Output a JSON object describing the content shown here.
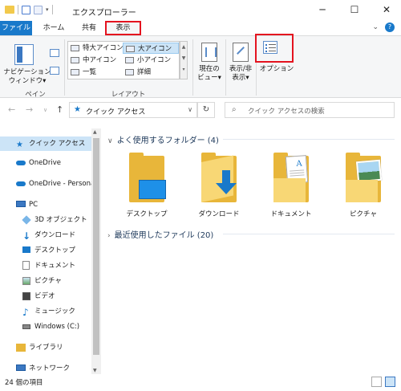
{
  "window": {
    "title": "エクスプローラー",
    "controls": [
      "─",
      "☐",
      "✕"
    ]
  },
  "ribbon_tabs": {
    "file": "ファイル",
    "home": "ホーム",
    "share": "共有",
    "view": "表示"
  },
  "ribbon": {
    "nav_pane": "ナビゲーション\nウィンドウ▾",
    "pane_group": "ペイン",
    "layout_group": "レイアウト",
    "layouts": {
      "extra_large": "特大アイコン",
      "large": "大アイコン",
      "medium": "中アイコン",
      "small": "小アイコン",
      "list": "一覧",
      "details": "詳細"
    },
    "current_view": "現在の\nビュー▾",
    "show_hide": "表示/非\n表示▾",
    "options": "オプション"
  },
  "address": {
    "path": "クイック アクセス",
    "search_placeholder": "クイック アクセスの検索"
  },
  "sidebar": {
    "quick_access": "クイック アクセス",
    "onedrive": "OneDrive",
    "onedrive_personal": "OneDrive - Persona",
    "pc": "PC",
    "objects3d": "3D オブジェクト",
    "downloads": "ダウンロード",
    "desktop": "デスクトップ",
    "documents": "ドキュメント",
    "pictures": "ピクチャ",
    "videos": "ビデオ",
    "music": "ミュージック",
    "windows_c": "Windows (C:)",
    "library": "ライブラリ",
    "network": "ネットワーク"
  },
  "content": {
    "frequent": "よく使用するフォルダー (4)",
    "recent": "最近使用したファイル (20)",
    "folders": [
      "デスクトップ",
      "ダウンロード",
      "ドキュメント",
      "ピクチャ"
    ]
  },
  "status": {
    "count": "24 個の項目"
  },
  "colors": {
    "accent": "#1979ca",
    "highlight": "#e4131f",
    "selection": "#cce4f7",
    "folder": "#f8d775"
  }
}
